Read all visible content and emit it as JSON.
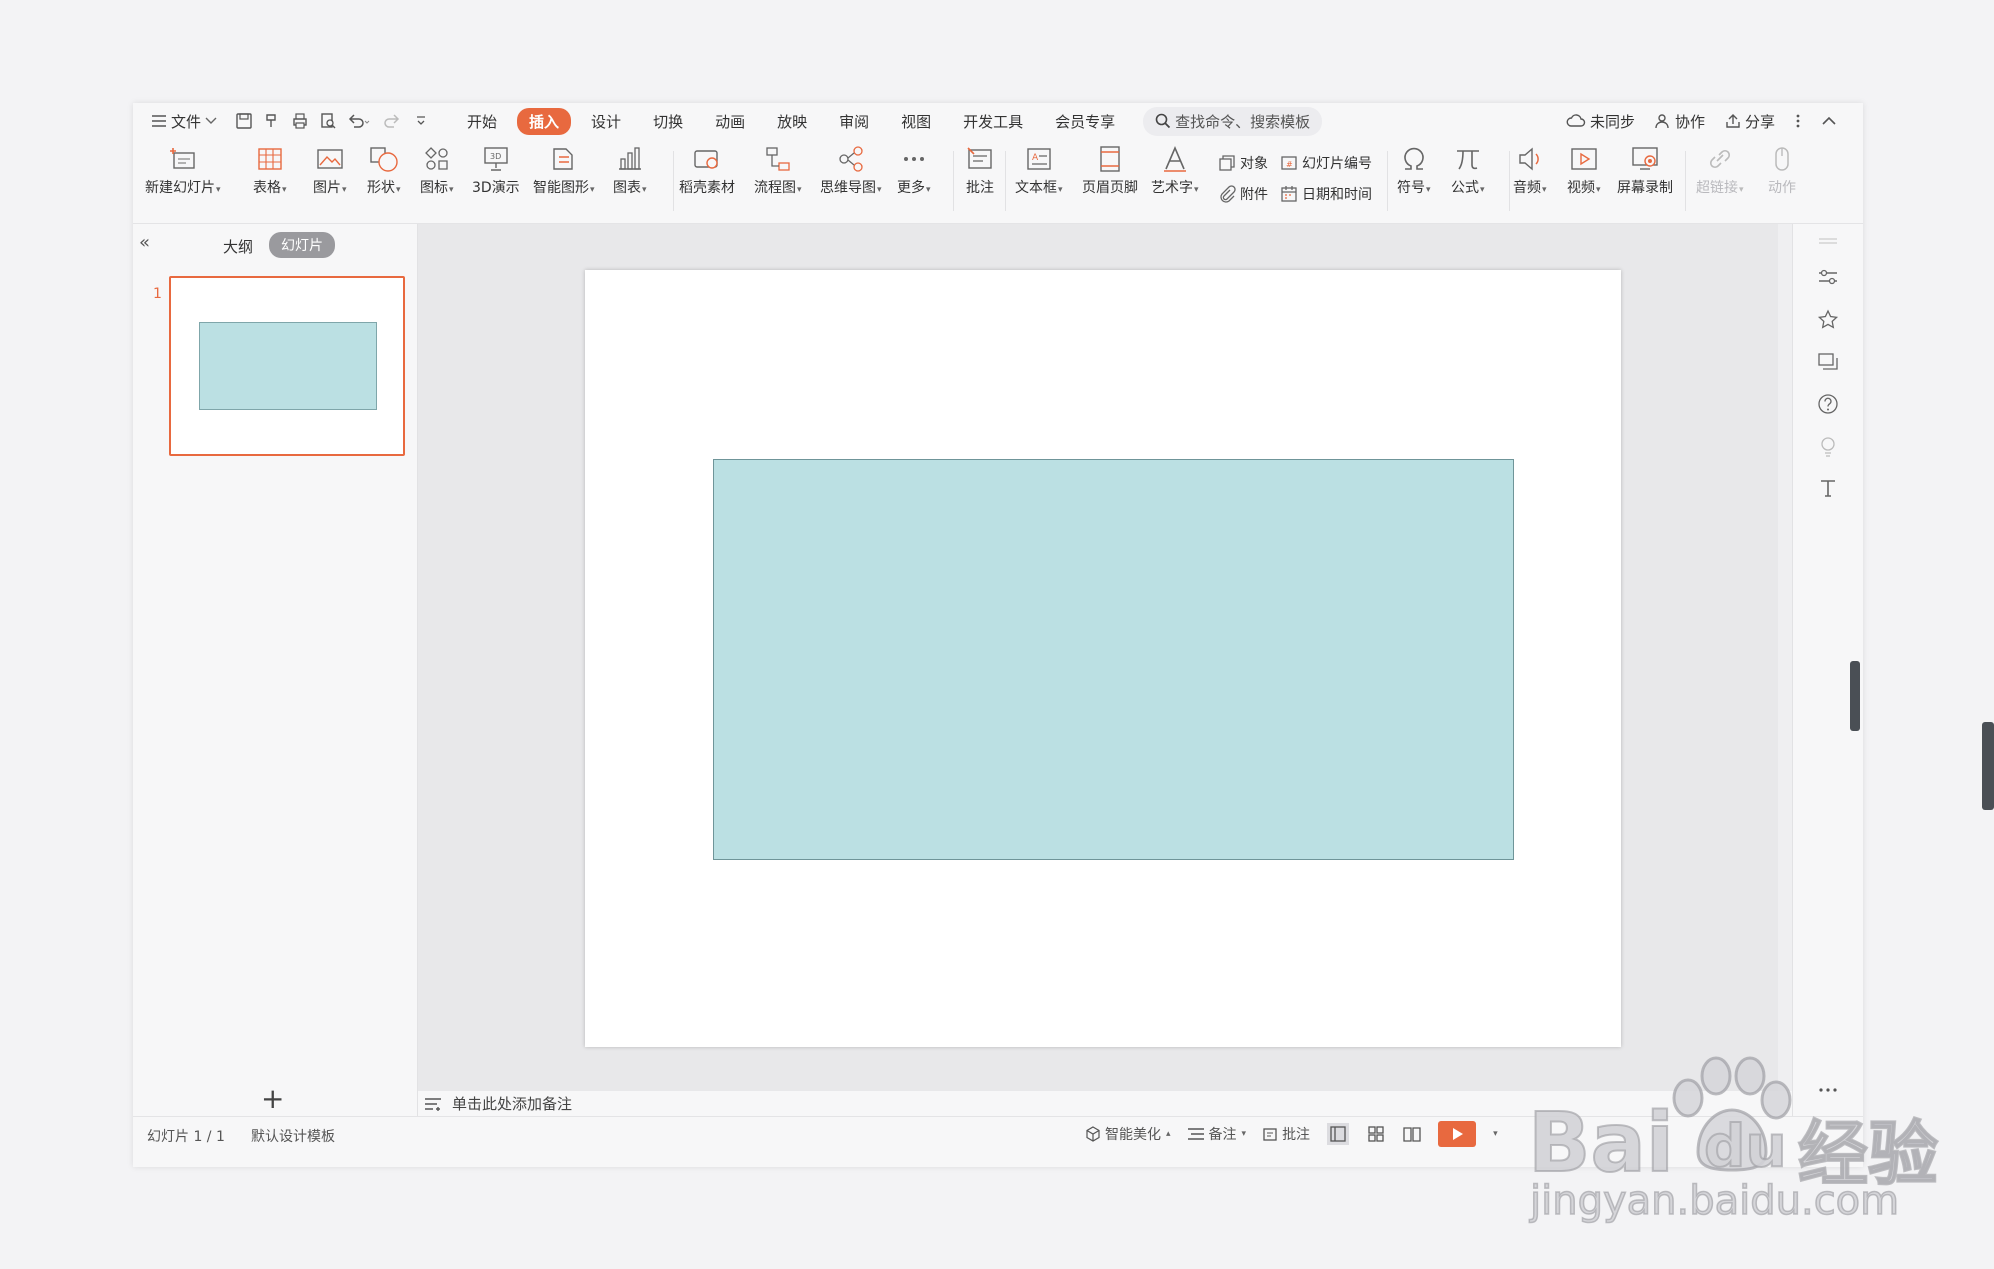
{
  "menu": {
    "file": "文件",
    "tabs": [
      "开始",
      "插入",
      "设计",
      "切换",
      "动画",
      "放映",
      "审阅",
      "视图",
      "开发工具",
      "会员专享"
    ],
    "active_tab_index": 1,
    "search_placeholder": "查找命令、搜索模板",
    "sync": "未同步",
    "collab": "协作",
    "share": "分享"
  },
  "ribbon": {
    "new_slide": "新建幻灯片",
    "table": "表格",
    "picture": "图片",
    "shape": "形状",
    "icon": "图标",
    "demo3d": "3D演示",
    "smartart": "智能图形",
    "chart": "图表",
    "material": "稻壳素材",
    "flowchart": "流程图",
    "mindmap": "思维导图",
    "more": "更多",
    "comment": "批注",
    "textbox": "文本框",
    "header_footer": "页眉页脚",
    "wordart": "艺术字",
    "object": "对象",
    "slide_number": "幻灯片编号",
    "attachment": "附件",
    "datetime": "日期和时间",
    "symbol": "符号",
    "formula": "公式",
    "audio": "音频",
    "video": "视频",
    "screen_record": "屏幕录制",
    "hyperlink": "超链接",
    "action": "动作"
  },
  "left_panel": {
    "tab_outline": "大纲",
    "tab_slides": "幻灯片",
    "thumb_number": "1"
  },
  "notes": {
    "placeholder": "单击此处添加备注"
  },
  "status": {
    "slide_count": "幻灯片 1 / 1",
    "template": "默认设计模板",
    "beautify": "智能美化",
    "notes": "备注",
    "comment": "批注"
  },
  "watermark": {
    "brand": "Bai",
    "brand2": "du",
    "cn": "经验",
    "url": "jingyan.baidu.com"
  },
  "colors": {
    "accent": "#e8693f",
    "shape_fill": "#bbe0e3",
    "shape_border": "#6f9599"
  }
}
